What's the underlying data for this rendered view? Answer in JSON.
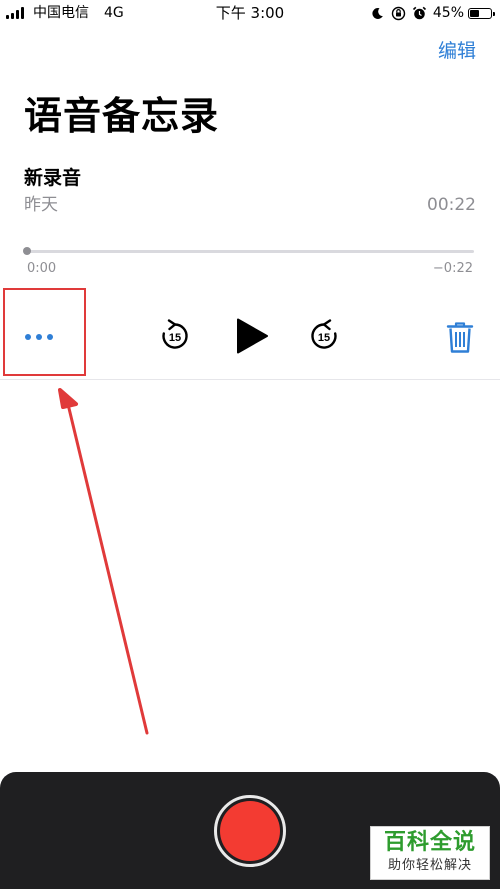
{
  "status_bar": {
    "carrier": "中国电信",
    "network": "4G",
    "time": "下午 3:00",
    "battery_percent": "45%",
    "battery_level": 0.45,
    "icons": [
      "moon-icon",
      "orientation-lock-icon",
      "alarm-icon",
      "battery-icon"
    ]
  },
  "header": {
    "edit_label": "编辑",
    "title": "语音备忘录"
  },
  "recording": {
    "name": "新录音",
    "date": "昨天",
    "duration": "00:22",
    "elapsed": "0:00",
    "remaining": "−0:22",
    "progress": 0.0
  },
  "controls": {
    "more_icon": "ellipsis-icon",
    "skip_back_label": "15",
    "skip_forward_label": "15",
    "play_icon": "play-icon",
    "delete_icon": "trash-icon"
  },
  "watermark": {
    "title": "百科全说",
    "subtitle": "助你轻松解决"
  },
  "colors": {
    "accent": "#2f7fd6",
    "record_red": "#f33b32",
    "annotation_red": "#e03a3a",
    "record_bar": "#1f1f21",
    "watermark_green": "#2e9c2e"
  }
}
